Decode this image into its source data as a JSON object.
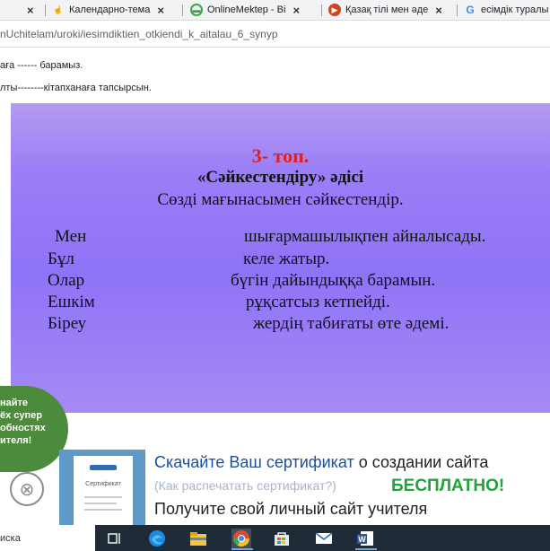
{
  "tabs": [
    {
      "label": "",
      "icon": "close-icon"
    },
    {
      "label": "Календарно-тема",
      "icon": "hand-favicon"
    },
    {
      "label": "OnlineMektep - Ві",
      "icon": "onlinemektep-favicon"
    },
    {
      "label": "Қазақ тілі мен әде",
      "icon": "video-favicon"
    },
    {
      "label": "есімдік туралы",
      "icon": "google-favicon"
    }
  ],
  "tab_close": "×",
  "address": {
    "url": "nUchitelam/uroki/iesimdiktien_otkiendi_k_aitalau_6_synyp"
  },
  "page_lines": [
    "аға ------ барамыз.",
    "лты--------кітапханаға тапсырсын."
  ],
  "slide": {
    "heading": "3- топ.",
    "method": "«Сәйкестендіру» әдісі",
    "instruction": "Сөзді мағынасымен сәйкестендір.",
    "left_words": [
      "Мен",
      "Бұл",
      "Олар",
      "Ешкім",
      "Біреу"
    ],
    "right_phrases": [
      "шығармашылықпен айналысады.",
      "келе жатыр.",
      "бүгін дайындыққа барамын.",
      "рұқсатсыз кетпейді.",
      "жердің табиғаты өте әдемі."
    ]
  },
  "promo": {
    "badge_text": "найте\nёх супер\nобностях\nителя!",
    "close_symbol": "⊗",
    "certificate_label": "Сертификат",
    "link": "Скачайте Ваш сертификат",
    "link_tail": " о создании сайта",
    "sub_link": "(Как распечатать сертификат?)",
    "free": "БЕСПЛАТНО!",
    "line2": "Получите свой личный сайт учителя"
  },
  "taskbar": {
    "search_label": "иска",
    "icons": [
      "task-view-icon",
      "edge-icon",
      "file-explorer-icon",
      "chrome-icon",
      "store-icon",
      "mail-icon",
      "word-icon"
    ]
  },
  "colors": {
    "heading_red": "#e02020",
    "slide_purple": "#8f73f6",
    "link_blue": "#1a4f9c",
    "free_green": "#21a33c",
    "badge_green": "#4d8b3c",
    "taskbar": "#1f2b36"
  }
}
